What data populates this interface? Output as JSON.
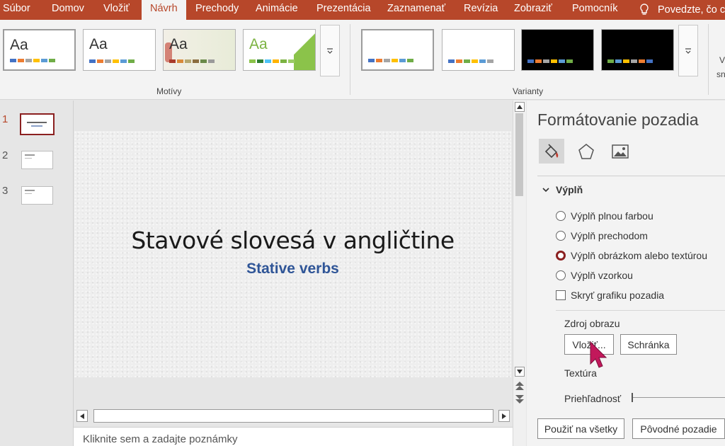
{
  "tabs": [
    "Súbor",
    "Domov",
    "Vložiť",
    "Návrh",
    "Prechody",
    "Animácie",
    "Prezentácia",
    "Zaznamenať",
    "Revízia",
    "Zobraziť",
    "Pomocník"
  ],
  "tell_me": "Povedzte, čo c",
  "ribbon": {
    "themes_label": "Motívy",
    "variants_label": "Varianty",
    "theme_aa": "Aa",
    "right_partial_1": "V",
    "right_partial_2": "sn"
  },
  "colors": {
    "accent": "#b7472a",
    "swatches": [
      "#4472c4",
      "#ed7d31",
      "#a5a5a5",
      "#ffc000",
      "#5b9bd5",
      "#70ad47"
    ]
  },
  "slides": {
    "numbers": [
      "1",
      "2",
      "3"
    ],
    "active": 1
  },
  "slide": {
    "title": "Stavové slovesá v angličtine",
    "subtitle": "Stative verbs"
  },
  "notes_placeholder": "Kliknite sem a zadajte poznámky",
  "format_pane": {
    "title": "Formátovanie pozadia",
    "section": "Výplň",
    "options": [
      "Výplň plnou farbou",
      "Výplň prechodom",
      "Výplň obrázkom alebo textúrou",
      "Výplň vzorkou"
    ],
    "selected_option": 2,
    "hide_graphics": "Skryť grafiku pozadia",
    "image_source": "Zdroj obrazu",
    "insert_button": "Vložiť...",
    "clipboard_button": "Schránka",
    "texture": "Textúra",
    "transparency": "Priehľadnosť",
    "apply_all": "Použiť na všetky",
    "reset_bg": "Pôvodné pozadie"
  }
}
